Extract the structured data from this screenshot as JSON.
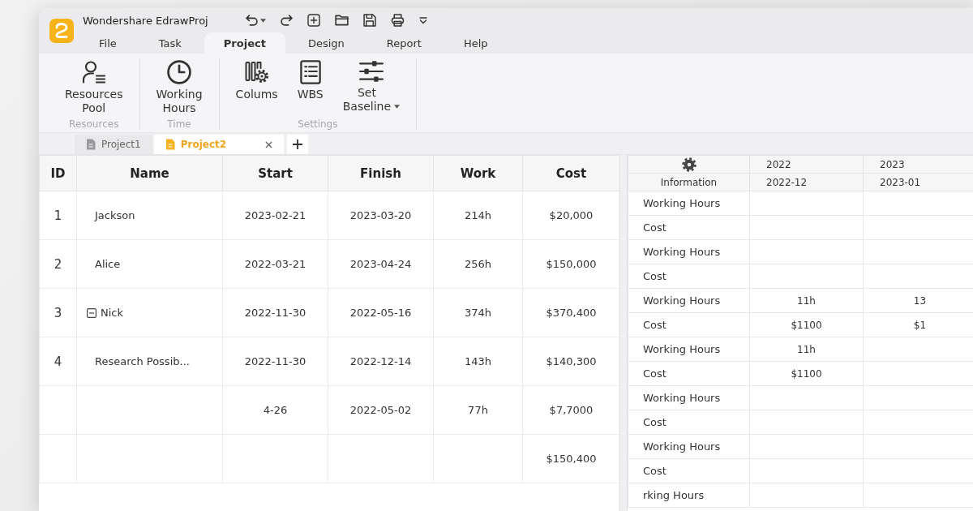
{
  "window": {
    "title": "Wondershare EdrawProj"
  },
  "menu_tabs": [
    {
      "label": "File",
      "selected": false
    },
    {
      "label": "Task",
      "selected": false
    },
    {
      "label": "Project",
      "selected": true
    },
    {
      "label": "Design",
      "selected": false
    },
    {
      "label": "Report",
      "selected": false
    },
    {
      "label": "Help",
      "selected": false
    }
  ],
  "ribbon": {
    "groups": [
      {
        "label": "Resources",
        "buttons": [
          {
            "label": "Resources Pool"
          }
        ]
      },
      {
        "label": "Time",
        "buttons": [
          {
            "label": "Working Hours"
          }
        ]
      },
      {
        "label": "Settings",
        "buttons": [
          {
            "label": "Colums"
          },
          {
            "label": "WBS"
          },
          {
            "label": "Set Baseline",
            "dropdown": true
          }
        ]
      }
    ]
  },
  "doc_tabs": [
    {
      "label": "Project1",
      "selected": false
    },
    {
      "label": "Project2",
      "selected": true
    }
  ],
  "table": {
    "columns": [
      "ID",
      "Name",
      "Start",
      "Finish",
      "Work",
      "Cost"
    ],
    "rows": [
      {
        "kind": "item",
        "id": "1",
        "name": "Jackson",
        "start": "2023-02-21",
        "finish": "2023-03-20",
        "work": "214h",
        "cost": "$20,000"
      },
      {
        "kind": "item",
        "id": "2",
        "name": "Alice",
        "start": "2022-03-21",
        "finish": "2023-04-24",
        "work": "256h",
        "cost": "$150,000"
      },
      {
        "kind": "group",
        "expanded": true,
        "id": "3",
        "name": "Nick",
        "start": "2022-11-30",
        "finish": "2022-05-16",
        "work": "374h",
        "cost": "$370,400"
      },
      {
        "kind": "item",
        "id": "4",
        "name": "Research Possib...",
        "start": "2022-11-30",
        "finish": "2022-12-14",
        "work": "143h",
        "cost": "$140,300"
      },
      {
        "kind": "item",
        "start": "4-26",
        "finish": "2022-05-02",
        "work": "77h",
        "cost": "$7,7000"
      },
      {
        "kind": "item",
        "cost": "$150,400"
      }
    ]
  },
  "timeline": {
    "info_header": "Information",
    "years": [
      "2022",
      "2023"
    ],
    "months": [
      "2022-12",
      "2023-01"
    ],
    "rows": [
      {
        "info": "Working Hours"
      },
      {
        "info": "Cost"
      },
      {
        "info": "Working Hours"
      },
      {
        "info": "Cost"
      },
      {
        "info": "Working Hours",
        "values": [
          "11h",
          "13"
        ]
      },
      {
        "info": "Cost",
        "values": [
          "$1100",
          "$1"
        ]
      },
      {
        "info": "Working Hours",
        "values": [
          "11h"
        ]
      },
      {
        "info": "Cost",
        "values": [
          "$1100"
        ]
      },
      {
        "info": "Working Hours"
      },
      {
        "info": "Cost"
      },
      {
        "info": "Working Hours"
      },
      {
        "info": "Cost"
      },
      {
        "info": "rking Hours"
      }
    ]
  }
}
